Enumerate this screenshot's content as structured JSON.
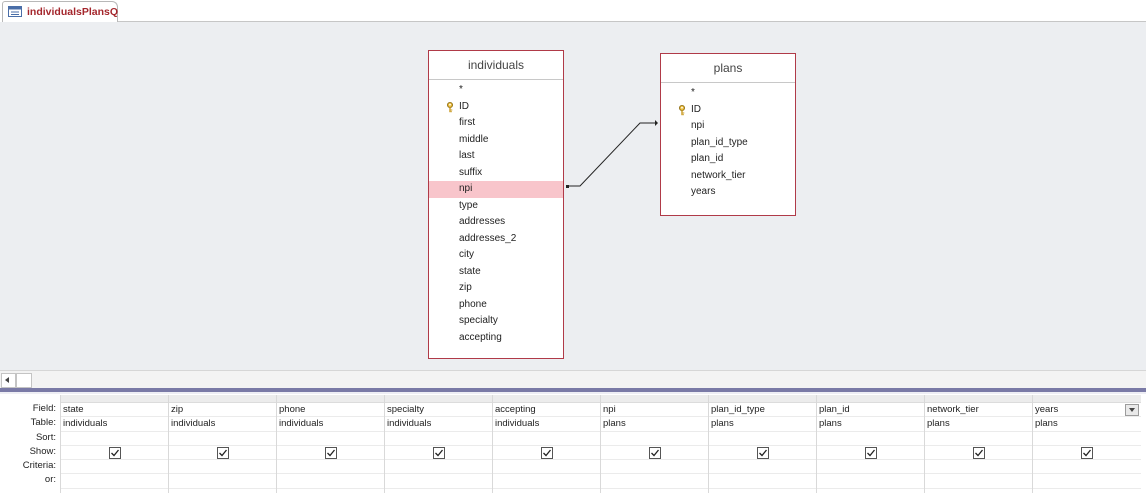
{
  "tab": {
    "title": "individualsPlansQ",
    "icon": "query-icon"
  },
  "tables": {
    "individuals": {
      "title": "individuals",
      "fields": [
        "*",
        "ID",
        "first",
        "middle",
        "last",
        "suffix",
        "npi",
        "type",
        "addresses",
        "addresses_2",
        "city",
        "state",
        "zip",
        "phone",
        "specialty",
        "accepting"
      ],
      "key_field": "ID",
      "selected_field": "npi"
    },
    "plans": {
      "title": "plans",
      "fields": [
        "*",
        "ID",
        "npi",
        "plan_id_type",
        "plan_id",
        "network_tier",
        "years"
      ],
      "key_field": "ID"
    }
  },
  "grid": {
    "row_labels": [
      "Field:",
      "Table:",
      "Sort:",
      "Show:",
      "Criteria:",
      "or:"
    ],
    "columns": [
      {
        "field": "state",
        "table": "individuals",
        "show": true
      },
      {
        "field": "zip",
        "table": "individuals",
        "show": true
      },
      {
        "field": "phone",
        "table": "individuals",
        "show": true
      },
      {
        "field": "specialty",
        "table": "individuals",
        "show": true
      },
      {
        "field": "accepting",
        "table": "individuals",
        "show": true
      },
      {
        "field": "npi",
        "table": "plans",
        "show": true
      },
      {
        "field": "plan_id_type",
        "table": "plans",
        "show": true
      },
      {
        "field": "plan_id",
        "table": "plans",
        "show": true
      },
      {
        "field": "network_tier",
        "table": "plans",
        "show": true
      },
      {
        "field": "years",
        "table": "plans",
        "show": true
      }
    ]
  },
  "colors": {
    "accent": "#a4262c",
    "table_border": "#b03a48",
    "selection": "#f8c5cb",
    "splitter": "#7a7aa6"
  }
}
